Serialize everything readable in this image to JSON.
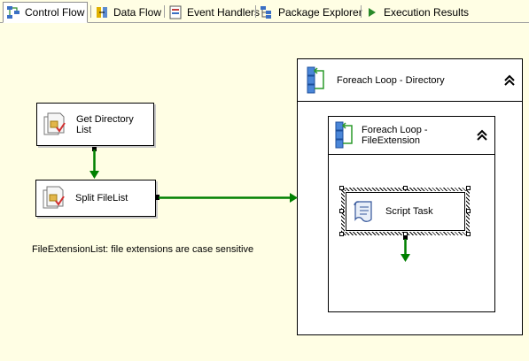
{
  "tabs": [
    {
      "label": "Control Flow",
      "icon": "control-flow-icon",
      "active": true
    },
    {
      "label": "Data Flow",
      "icon": "data-flow-icon",
      "active": false
    },
    {
      "label": "Event Handlers",
      "icon": "event-handlers-icon",
      "active": false
    },
    {
      "label": "Package Explorer",
      "icon": "package-explorer-icon",
      "active": false
    },
    {
      "label": "Execution Results",
      "icon": "execution-results-icon",
      "active": false
    }
  ],
  "tasks": {
    "get_directory_list": {
      "label_line1": "Get Directory",
      "label_line2": "List",
      "icon": "task-icon"
    },
    "split_filelist": {
      "label": "Split FileList",
      "icon": "task-icon"
    },
    "script_task": {
      "label": "Script Task",
      "icon": "script-icon"
    }
  },
  "containers": {
    "foreach_directory": {
      "label": "Foreach Loop - Directory",
      "icon": "foreach-loop-icon",
      "collapse_icon": "double-chevron-up-icon"
    },
    "foreach_fileextension": {
      "label_line1": "Foreach Loop -",
      "label_line2": "FileExtension",
      "icon": "foreach-loop-icon",
      "collapse_icon": "double-chevron-up-icon"
    }
  },
  "annotation": "FileExtensionList:  file extensions are case sensitive",
  "colors": {
    "canvas": "#fffee4",
    "precedence_success": "#008000"
  }
}
